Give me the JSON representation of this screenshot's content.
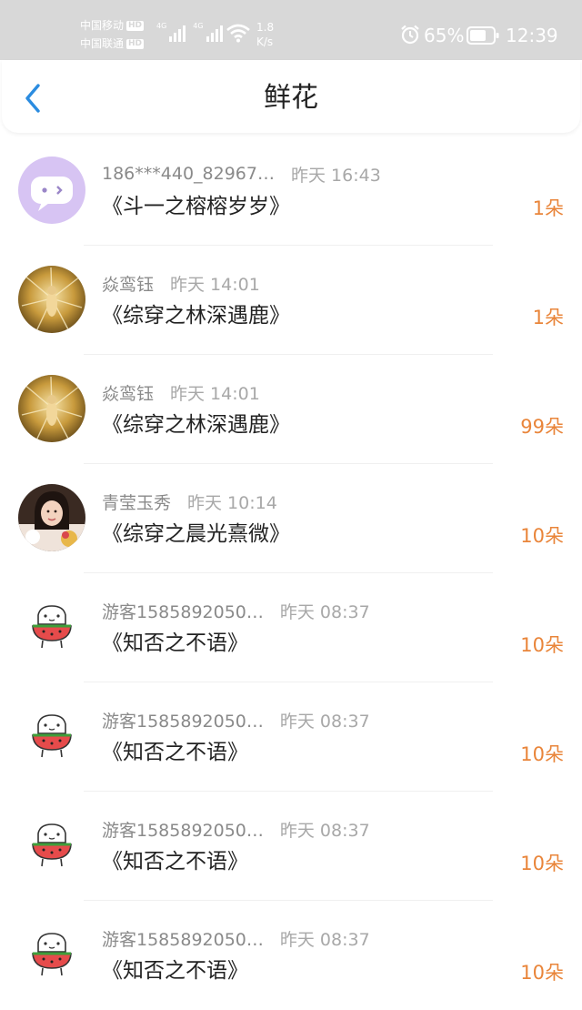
{
  "status_bar": {
    "carrier1": "中国移动",
    "carrier2": "中国联通",
    "hd": "HD",
    "net1": "4G",
    "net2": "4G",
    "speed_value": "1.8",
    "speed_unit": "K/s",
    "battery": "65%",
    "time": "12:39"
  },
  "header": {
    "title": "鲜花",
    "back_icon": "chevron-left-icon",
    "accent_color": "#2b8ce0"
  },
  "colors": {
    "count": "#e9853a",
    "username": "#8a8a8a",
    "time": "#a8a8a8",
    "book": "#222222"
  },
  "items": [
    {
      "user": "186***440_82967…",
      "time": "昨天 16:43",
      "book": "《斗一之榕榕岁岁》",
      "count": "1朵",
      "avatar": "chat-bubble-avatar"
    },
    {
      "user": "焱鸾钰",
      "time": "昨天 14:01",
      "book": "《综穿之林深遇鹿》",
      "count": "1朵",
      "avatar": "golden-photo-avatar"
    },
    {
      "user": "焱鸾钰",
      "time": "昨天 14:01",
      "book": "《综穿之林深遇鹿》",
      "count": "99朵",
      "avatar": "golden-photo-avatar"
    },
    {
      "user": "青莹玉秀",
      "time": "昨天 10:14",
      "book": "《综穿之晨光熹微》",
      "count": "10朵",
      "avatar": "portrait-photo-avatar"
    },
    {
      "user": "游客1585892050…",
      "time": "昨天 08:37",
      "book": "《知否之不语》",
      "count": "10朵",
      "avatar": "watermelon-cartoon-avatar"
    },
    {
      "user": "游客1585892050…",
      "time": "昨天 08:37",
      "book": "《知否之不语》",
      "count": "10朵",
      "avatar": "watermelon-cartoon-avatar"
    },
    {
      "user": "游客1585892050…",
      "time": "昨天 08:37",
      "book": "《知否之不语》",
      "count": "10朵",
      "avatar": "watermelon-cartoon-avatar"
    },
    {
      "user": "游客1585892050…",
      "time": "昨天 08:37",
      "book": "《知否之不语》",
      "count": "10朵",
      "avatar": "watermelon-cartoon-avatar"
    }
  ]
}
